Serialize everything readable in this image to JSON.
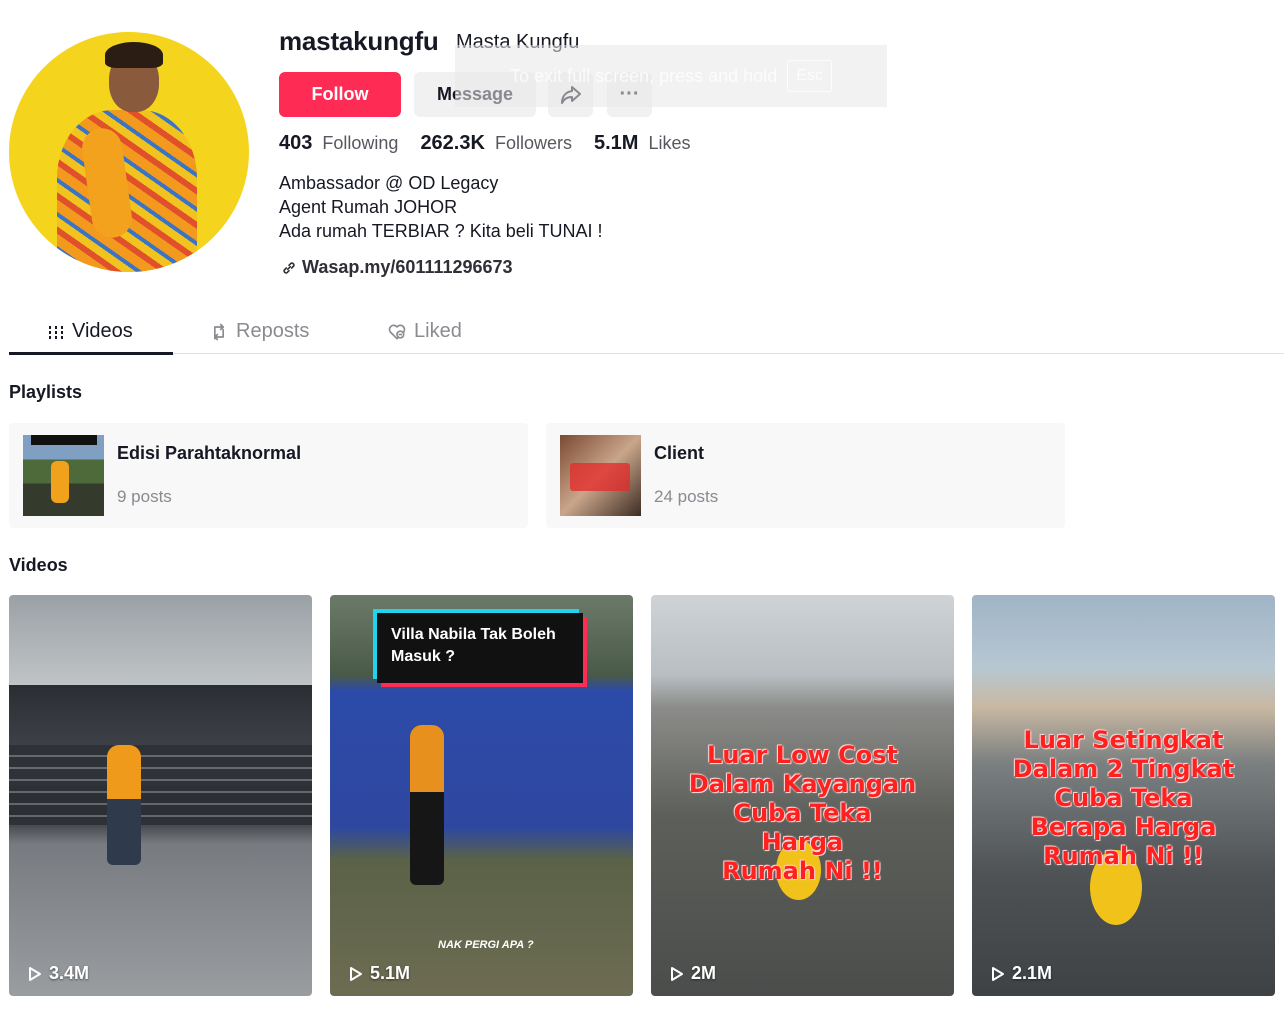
{
  "profile": {
    "username": "mastakungfu",
    "nickname": "Masta Kungfu",
    "follow_label": "Follow",
    "message_label": "Message",
    "more_label": "···",
    "fullscreen_hint": "To exit full screen, press and hold",
    "fullscreen_key": "Esc",
    "stats": {
      "following_count": "403",
      "following_label": "Following",
      "followers_count": "262.3K",
      "followers_label": "Followers",
      "likes_count": "5.1M",
      "likes_label": "Likes"
    },
    "bio": [
      "Ambassador @ OD Legacy",
      "Agent Rumah JOHOR",
      "Ada rumah TERBIAR ? Kita beli TUNAI !"
    ],
    "link": "Wasap.my/601111296673"
  },
  "tabs": [
    {
      "label": "Videos",
      "icon": "grid-icon",
      "active": true
    },
    {
      "label": "Reposts",
      "icon": "repost-icon",
      "active": false
    },
    {
      "label": "Liked",
      "icon": "liked-heart-icon",
      "active": false
    }
  ],
  "playlists": {
    "title": "Playlists",
    "items": [
      {
        "title": "Edisi Parahtaknormal",
        "count": "9 posts"
      },
      {
        "title": "Client",
        "count": "24 posts"
      }
    ]
  },
  "videos": {
    "title": "Videos",
    "items": [
      {
        "views": "3.4M"
      },
      {
        "views": "5.1M",
        "caption": "Villa Nabila Tak Boleh Masuk ?",
        "subcaption": "NAK PERGI APA ?"
      },
      {
        "views": "2M",
        "overlay": [
          "Luar Low Cost",
          "Dalam Kayangan",
          "Cuba Teka",
          "Harga",
          "Rumah Ni !!"
        ]
      },
      {
        "views": "2.1M",
        "overlay": [
          "Luar Setingkat",
          "Dalam 2 Tingkat",
          "Cuba Teka",
          "Berapa Harga",
          "Rumah Ni !!"
        ]
      }
    ]
  },
  "colors": {
    "follow_button": "#fe2c55",
    "avatar_background": "#f4d41c",
    "overlay_text": "#ff2020"
  }
}
